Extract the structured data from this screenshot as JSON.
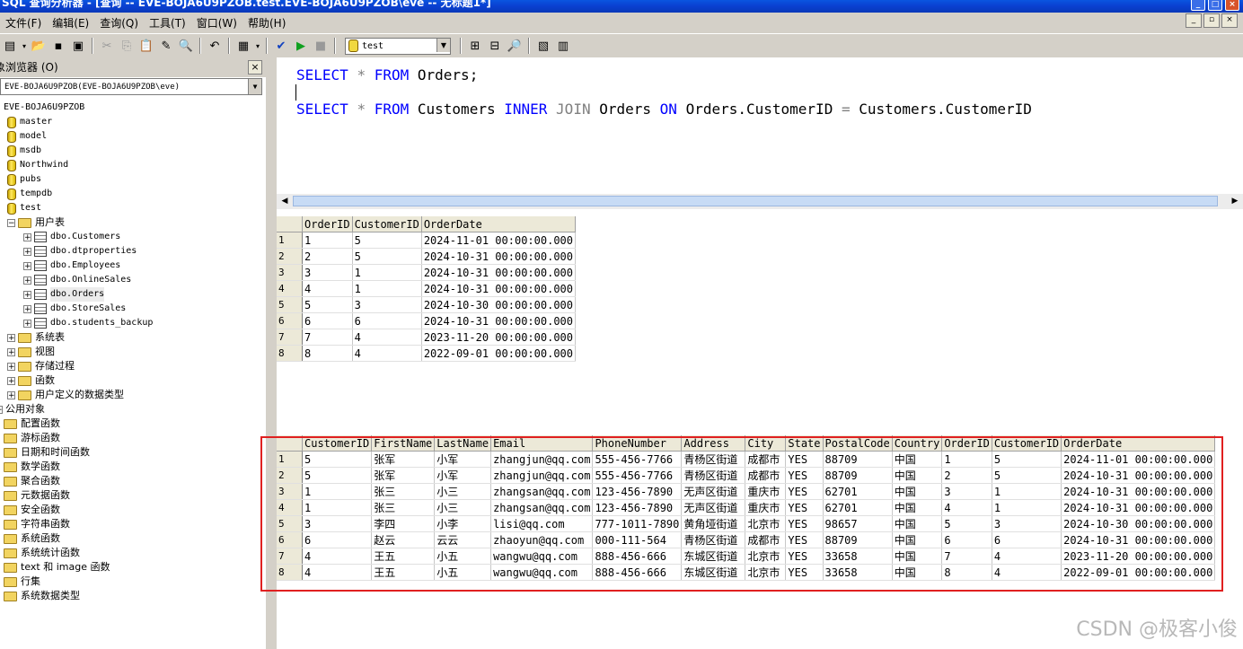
{
  "window": {
    "title": "SQL 查询分析器 - [查询 -- EVE-BOJA6U9PZOB.test.EVE-BOJA6U9PZOB\\eve -- 无标题1*]"
  },
  "menu": [
    "文件(F)",
    "编辑(E)",
    "查询(Q)",
    "工具(T)",
    "窗口(W)",
    "帮助(H)"
  ],
  "toolbar": {
    "database": "test"
  },
  "object_browser": {
    "title": "对象浏览器 (O)",
    "server_select": "EVE-BOJA6U9PZOB(EVE-BOJA6U9PZOB\\eve)",
    "server_node": "EVE-BOJA6U9PZOB",
    "databases": [
      "master",
      "model",
      "msdb",
      "Northwind",
      "pubs",
      "tempdb",
      "test"
    ],
    "user_tables_folder": "用户表",
    "tables": [
      "dbo.Customers",
      "dbo.dtproperties",
      "dbo.Employees",
      "dbo.OnlineSales",
      "dbo.Orders",
      "dbo.StoreSales",
      "dbo.students_backup"
    ],
    "db_folders": [
      "系统表",
      "视图",
      "存储过程",
      "函数",
      "用户定义的数据类型"
    ],
    "common_objects": "公用对象",
    "common_folders": [
      "配置函数",
      "游标函数",
      "日期和时间函数",
      "数学函数",
      "聚合函数",
      "元数据函数",
      "安全函数",
      "字符串函数",
      "系统函数",
      "系统统计函数",
      "text 和 image 函数",
      "行集",
      "系统数据类型"
    ]
  },
  "editor": {
    "line1": {
      "kw1": "SELECT",
      "star": "*",
      "kw2": "FROM",
      "rest": "Orders;"
    },
    "line3": {
      "kw1": "SELECT",
      "star": "*",
      "kw2": "FROM",
      "t1": "Customers",
      "kw3": "INNER",
      "kw4": "JOIN",
      "t2": "Orders",
      "kw5": "ON",
      "c1": "Orders.CustomerID",
      "eq": "=",
      "c2": "Customers.CustomerID"
    }
  },
  "result1": {
    "columns": [
      "OrderID",
      "CustomerID",
      "OrderDate"
    ],
    "rows": [
      [
        "1",
        "5",
        "2024-11-01 00:00:00.000"
      ],
      [
        "2",
        "5",
        "2024-10-31 00:00:00.000"
      ],
      [
        "3",
        "1",
        "2024-10-31 00:00:00.000"
      ],
      [
        "4",
        "1",
        "2024-10-31 00:00:00.000"
      ],
      [
        "5",
        "3",
        "2024-10-30 00:00:00.000"
      ],
      [
        "6",
        "6",
        "2024-10-31 00:00:00.000"
      ],
      [
        "7",
        "4",
        "2023-11-20 00:00:00.000"
      ],
      [
        "8",
        "4",
        "2022-09-01 00:00:00.000"
      ]
    ]
  },
  "result2": {
    "columns": [
      "CustomerID",
      "FirstName",
      "LastName",
      "Email",
      "PhoneNumber",
      "Address",
      "City",
      "State",
      "PostalCode",
      "Country",
      "OrderID",
      "CustomerID",
      "OrderDate"
    ],
    "rows": [
      [
        "5",
        "张军",
        "小军",
        "zhangjun@qq.com",
        "555-456-7766",
        "青杨区街道",
        "成都市",
        "YES",
        "88709",
        "中国",
        "1",
        "5",
        "2024-11-01 00:00:00.000"
      ],
      [
        "5",
        "张军",
        "小军",
        "zhangjun@qq.com",
        "555-456-7766",
        "青杨区街道",
        "成都市",
        "YES",
        "88709",
        "中国",
        "2",
        "5",
        "2024-10-31 00:00:00.000"
      ],
      [
        "1",
        "张三",
        "小三",
        "zhangsan@qq.com",
        "123-456-7890",
        "无声区街道",
        "重庆市",
        "YES",
        "62701",
        "中国",
        "3",
        "1",
        "2024-10-31 00:00:00.000"
      ],
      [
        "1",
        "张三",
        "小三",
        "zhangsan@qq.com",
        "123-456-7890",
        "无声区街道",
        "重庆市",
        "YES",
        "62701",
        "中国",
        "4",
        "1",
        "2024-10-31 00:00:00.000"
      ],
      [
        "3",
        "李四",
        "小李",
        "lisi@qq.com",
        "777-1011-7890",
        "黄角垭街道",
        "北京市",
        "YES",
        "98657",
        "中国",
        "5",
        "3",
        "2024-10-30 00:00:00.000"
      ],
      [
        "6",
        "赵云",
        "云云",
        "zhaoyun@qq.com",
        "000-111-564",
        "青杨区街道",
        "成都市",
        "YES",
        "88709",
        "中国",
        "6",
        "6",
        "2024-10-31 00:00:00.000"
      ],
      [
        "4",
        "王五",
        "小五",
        "wangwu@qq.com",
        "888-456-666",
        "东城区街道",
        "北京市",
        "YES",
        "33658",
        "中国",
        "7",
        "4",
        "2023-11-20 00:00:00.000"
      ],
      [
        "4",
        "王五",
        "小五",
        "wangwu@qq.com",
        "888-456-666",
        "东城区街道",
        "北京市",
        "YES",
        "33658",
        "中国",
        "8",
        "4",
        "2022-09-01 00:00:00.000"
      ]
    ]
  },
  "watermark": "CSDN @极客小俊"
}
